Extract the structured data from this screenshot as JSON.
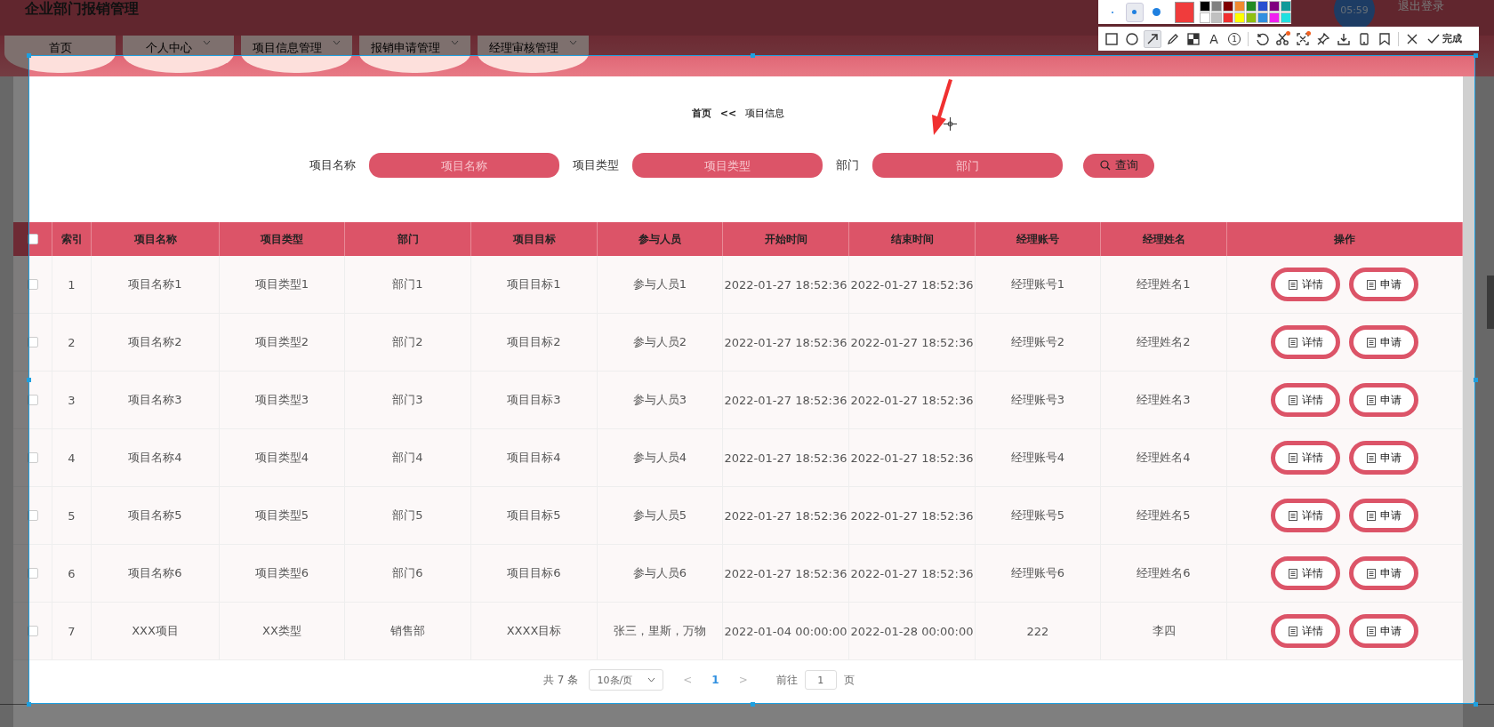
{
  "header": {
    "title": "企业部门报销管理",
    "timer": "05:59",
    "logout": "退出登录"
  },
  "nav": [
    {
      "label": "首页",
      "has_menu": false
    },
    {
      "label": "个人中心",
      "has_menu": true
    },
    {
      "label": "项目信息管理",
      "has_menu": true
    },
    {
      "label": "报销申请管理",
      "has_menu": true
    },
    {
      "label": "经理审核管理",
      "has_menu": true
    }
  ],
  "breadcrumb": {
    "home": "首页",
    "separator": "<<",
    "current": "项目信息"
  },
  "search": {
    "fields": [
      {
        "label": "项目名称",
        "placeholder": "项目名称"
      },
      {
        "label": "项目类型",
        "placeholder": "项目类型"
      },
      {
        "label": "部门",
        "placeholder": "部门"
      }
    ],
    "button": "查询"
  },
  "table": {
    "select_all": {
      "checked": false
    },
    "columns": [
      "索引",
      "项目名称",
      "项目类型",
      "部门",
      "项目目标",
      "参与人员",
      "开始时间",
      "结束时间",
      "经理账号",
      "经理姓名",
      "操作"
    ],
    "rows": [
      {
        "checked": false,
        "cells": [
          "1",
          "项目名称1",
          "项目类型1",
          "部门1",
          "项目目标1",
          "参与人员1",
          "2022-01-27 18:52:36",
          "2022-01-27 18:52:36",
          "经理账号1",
          "经理姓名1"
        ],
        "actions": [
          "详情",
          "申请"
        ]
      },
      {
        "checked": false,
        "cells": [
          "2",
          "项目名称2",
          "项目类型2",
          "部门2",
          "项目目标2",
          "参与人员2",
          "2022-01-27 18:52:36",
          "2022-01-27 18:52:36",
          "经理账号2",
          "经理姓名2"
        ],
        "actions": [
          "详情",
          "申请"
        ]
      },
      {
        "checked": false,
        "cells": [
          "3",
          "项目名称3",
          "项目类型3",
          "部门3",
          "项目目标3",
          "参与人员3",
          "2022-01-27 18:52:36",
          "2022-01-27 18:52:36",
          "经理账号3",
          "经理姓名3"
        ],
        "actions": [
          "详情",
          "申请"
        ]
      },
      {
        "checked": false,
        "cells": [
          "4",
          "项目名称4",
          "项目类型4",
          "部门4",
          "项目目标4",
          "参与人员4",
          "2022-01-27 18:52:36",
          "2022-01-27 18:52:36",
          "经理账号4",
          "经理姓名4"
        ],
        "actions": [
          "详情",
          "申请"
        ]
      },
      {
        "checked": false,
        "cells": [
          "5",
          "项目名称5",
          "项目类型5",
          "部门5",
          "项目目标5",
          "参与人员5",
          "2022-01-27 18:52:36",
          "2022-01-27 18:52:36",
          "经理账号5",
          "经理姓名5"
        ],
        "actions": [
          "详情",
          "申请"
        ]
      },
      {
        "checked": false,
        "cells": [
          "6",
          "项目名称6",
          "项目类型6",
          "部门6",
          "项目目标6",
          "参与人员6",
          "2022-01-27 18:52:36",
          "2022-01-27 18:52:36",
          "经理账号6",
          "经理姓名6"
        ],
        "actions": [
          "详情",
          "申请"
        ]
      },
      {
        "checked": false,
        "cells": [
          "7",
          "XXX项目",
          "XX类型",
          "销售部",
          "XXXX目标",
          "张三，里斯，万物",
          "2022-01-04 00:00:00",
          "2022-01-28 00:00:00",
          "222",
          "李四"
        ],
        "actions": [
          "详情",
          "申请"
        ]
      }
    ]
  },
  "pagination": {
    "total": "共 7 条",
    "page_size": "10条/页",
    "prev": "<",
    "pages": [
      {
        "label": "1",
        "selected": true
      }
    ],
    "next": ">",
    "goto_label": "前往",
    "goto_value": "1",
    "goto_suffix": "页"
  },
  "capture_toolbar": {
    "pen_sizes": [
      {
        "kind": "small",
        "selected": false
      },
      {
        "kind": "medium",
        "selected": true
      },
      {
        "kind": "large",
        "selected": false
      }
    ],
    "palette": [
      {
        "color": "#000000"
      },
      {
        "color": "#808080"
      },
      {
        "color": "#800000"
      },
      {
        "color": "#f08a30"
      },
      {
        "color": "#228b22"
      },
      {
        "color": "#2850d0"
      },
      {
        "color": "#800080"
      },
      {
        "color": "#109a9a"
      },
      {
        "color": "#ffffff"
      },
      {
        "color": "#c0c0c0"
      },
      {
        "color": "#f03030"
      },
      {
        "color": "#ffff00"
      },
      {
        "color": "#90c010"
      },
      {
        "color": "#3090e0"
      },
      {
        "color": "#f020f0"
      },
      {
        "color": "#20e0e0"
      }
    ],
    "tools": [
      {
        "kind": "rectangle",
        "selected": false
      },
      {
        "kind": "ellipse",
        "selected": false
      },
      {
        "kind": "arrow",
        "selected": true
      },
      {
        "kind": "pencil",
        "selected": false
      },
      {
        "kind": "mosaic",
        "selected": false
      },
      {
        "kind": "text",
        "glyph": "A",
        "selected": false
      },
      {
        "kind": "number",
        "glyph": "1",
        "selected": false
      },
      {
        "kind": "divider"
      },
      {
        "kind": "undo",
        "selected": false
      },
      {
        "kind": "scissors",
        "selected": false
      },
      {
        "kind": "scan",
        "selected": false
      },
      {
        "kind": "pin",
        "selected": false
      },
      {
        "kind": "download",
        "selected": false
      },
      {
        "kind": "phone",
        "selected": false
      },
      {
        "kind": "bookmark",
        "selected": false
      },
      {
        "kind": "divider"
      },
      {
        "kind": "close",
        "selected": false
      }
    ],
    "done": "完成"
  }
}
